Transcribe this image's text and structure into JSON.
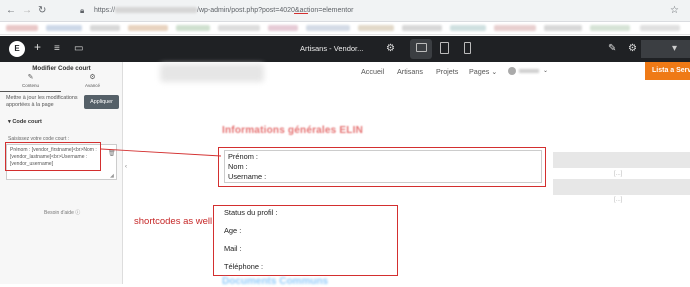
{
  "browser": {
    "url_prefix": "https://",
    "url_path": "/wp-admin/post.php?post=",
    "url_post_id": "4020",
    "url_suffix": "&action=elementor"
  },
  "editor": {
    "document_title": "Artisans - Vendor...",
    "panel_title": "Modifier Code court",
    "tab_content": "Contenu",
    "tab_advanced": "Avancé",
    "notice": "Mettre à jour les modifications apportées à la page",
    "apply_label": "Appliquer",
    "section_title": "Code court",
    "field_label": "Saisissez votre code court :",
    "code_lines": [
      "Prénom : [vendor_firstname]<br>Nom :",
      "[vendor_lastname]<br>Username :",
      "[vendor_username]"
    ],
    "help_label": "Besoin d'aide"
  },
  "site": {
    "nav": [
      "Accueil",
      "Artisans",
      "Projets",
      "Pages"
    ],
    "cta_label": "Lista a Servic"
  },
  "content": {
    "heading": "Informations générales ELIN",
    "box1_fields": [
      "Prénom :",
      "Nom :",
      "Username :"
    ],
    "box2_fields": [
      "Status du profil :",
      "Age :",
      "Mail :",
      "Téléphone :"
    ],
    "annotation": "shortcodes as well",
    "footer_heading": "Documents Communs",
    "dots": [
      "[...]",
      "[...]"
    ]
  },
  "colors": {
    "annotation_red": "#d32f2f",
    "cta_orange": "#ef7a16",
    "editor_dark": "#1f2124"
  }
}
